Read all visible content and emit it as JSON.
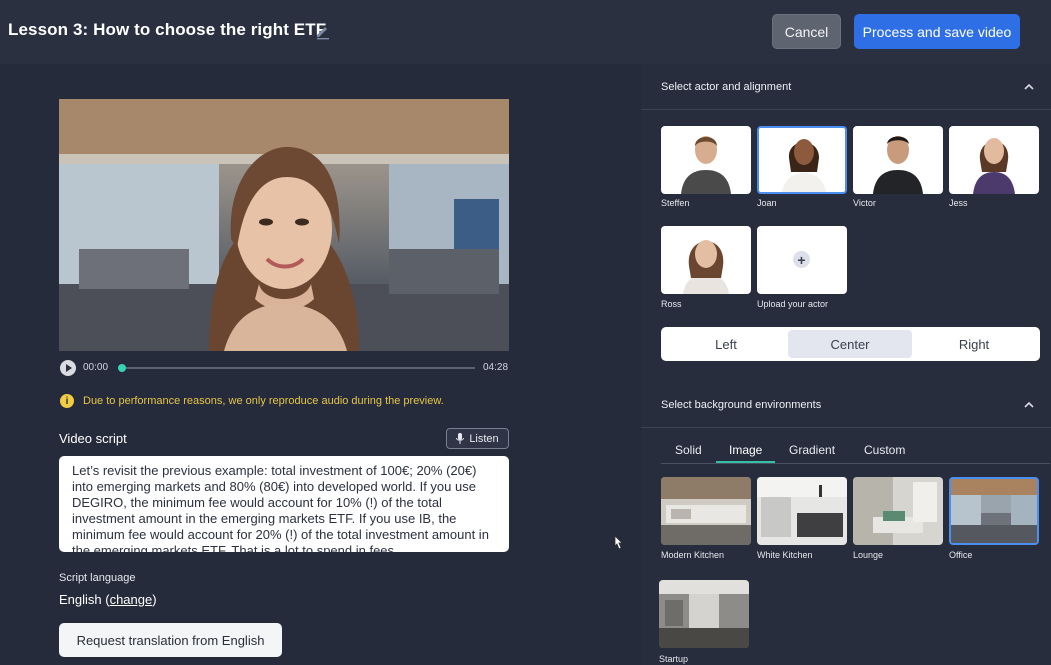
{
  "header": {
    "title": "Lesson 3: How to choose the right ETF",
    "cancel_label": "Cancel",
    "process_label": "Process and save video"
  },
  "player": {
    "time_start": "00:00",
    "time_end": "04:28",
    "progress": 0.0
  },
  "notice": {
    "icon": "info-icon",
    "text": "Due to performance reasons, we only reproduce audio during the preview."
  },
  "script": {
    "label": "Video script",
    "listen_label": "Listen",
    "text": "Let’s revisit the previous example: total investment of 100€; 20% (20€) into emerging markets and 80% (80€) into developed world. If you use DEGIRO, the minimum fee would account for 10% (!) of the total investment amount in the emerging markets ETF. If you use IB, the minimum fee would account for 20% (!) of the total investment amount in the emerging markets ETF. That is a lot to spend in fees."
  },
  "language": {
    "label": "Script language",
    "value": "English (",
    "change_link": "change",
    "close_paren": ")",
    "request_label": "Request translation from English"
  },
  "actors_section": {
    "title": "Select actor and alignment",
    "actors": [
      {
        "name": "Steffen",
        "selected": false,
        "shirt": "#4a4a4a"
      },
      {
        "name": "Joan",
        "selected": true,
        "shirt": "#f3f1ee"
      },
      {
        "name": "Victor",
        "selected": false,
        "shirt": "#222428"
      },
      {
        "name": "Jess",
        "selected": false,
        "shirt": "#4b3a6b"
      },
      {
        "name": "Ross",
        "selected": false,
        "shirt": "#e9e4df"
      }
    ],
    "upload_label": "Upload your actor",
    "alignments": [
      "Left",
      "Center",
      "Right"
    ],
    "selected_alignment": "Center"
  },
  "background_section": {
    "title": "Select background environments",
    "tabs": [
      "Solid",
      "Image",
      "Gradient",
      "Custom"
    ],
    "active_tab": "Image",
    "backgrounds": [
      {
        "name": "Modern Kitchen",
        "selected": false
      },
      {
        "name": "White Kitchen",
        "selected": false
      },
      {
        "name": "Lounge",
        "selected": false
      },
      {
        "name": "Office",
        "selected": true
      },
      {
        "name": "Startup",
        "selected": false
      }
    ]
  },
  "colors": {
    "accent_blue": "#2f6fe6",
    "accent_teal": "#36c2a8",
    "notice_yellow": "#e5c548"
  }
}
